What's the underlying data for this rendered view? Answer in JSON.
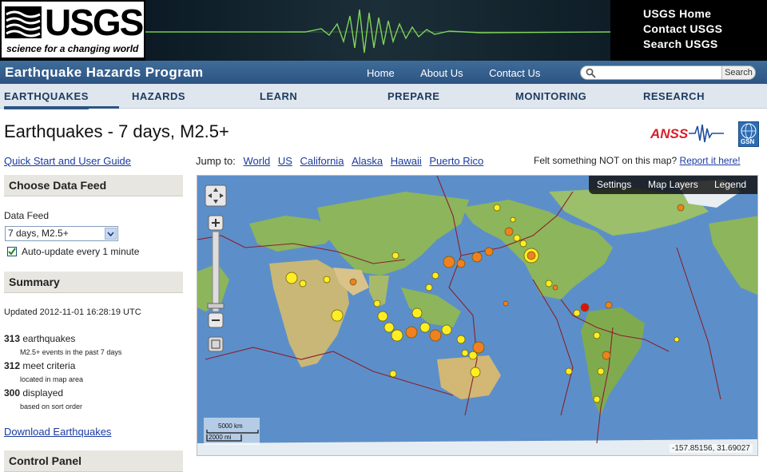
{
  "banner": {
    "logo_text": "USGS",
    "tagline": "science for a changing world",
    "links": [
      "USGS Home",
      "Contact USGS",
      "Search USGS"
    ]
  },
  "program": {
    "title": "Earthquake Hazards Program",
    "links": [
      "Home",
      "About Us",
      "Contact Us"
    ],
    "search_button": "Search",
    "search_placeholder": ""
  },
  "nav": {
    "items": [
      "EARTHQUAKES",
      "HAZARDS",
      "LEARN",
      "PREPARE",
      "MONITORING",
      "RESEARCH"
    ],
    "active": "EARTHQUAKES"
  },
  "page": {
    "title": "Earthquakes - 7 days, M2.5+",
    "anss_logo": "ANSS",
    "gsn_logo": "GSN"
  },
  "sidebar": {
    "quick_start": "Quick Start and User Guide",
    "choose_feed_heading": "Choose Data Feed",
    "data_feed_label": "Data Feed",
    "data_feed_value": "7 days, M2.5+",
    "auto_update_label": "Auto-update every 1 minute",
    "auto_update_checked": true,
    "summary_heading": "Summary",
    "updated": "Updated 2012-11-01 16:28:19 UTC",
    "stats": [
      {
        "count": "313",
        "label": "earthquakes",
        "sub": "M2.5+ events in the past 7 days"
      },
      {
        "count": "312",
        "label": "meet criteria",
        "sub": "located in map area"
      },
      {
        "count": "300",
        "label": "displayed",
        "sub": "based on sort order"
      }
    ],
    "download_link": "Download Earthquakes",
    "control_panel_heading": "Control Panel"
  },
  "map": {
    "jump_label": "Jump to:",
    "jump_links": [
      "World",
      "US",
      "California",
      "Alaska",
      "Hawaii",
      "Puerto Rico"
    ],
    "felt_text": "Felt something NOT on this map?",
    "report_link": "Report it here!",
    "controls": [
      "Settings",
      "Map Layers",
      "Legend"
    ],
    "scale_km": "5000 km",
    "scale_mi": "2000 mi",
    "coordinates": "-157.85156, 31.69027",
    "colors": {
      "ocean": "#5c8fc9",
      "land": "#8db55b",
      "desert": "#d9c38a",
      "plate": "#8a1f2a",
      "quake_yellow": "#ffee22",
      "quake_orange": "#f08020",
      "quake_red": "#e01010"
    }
  }
}
